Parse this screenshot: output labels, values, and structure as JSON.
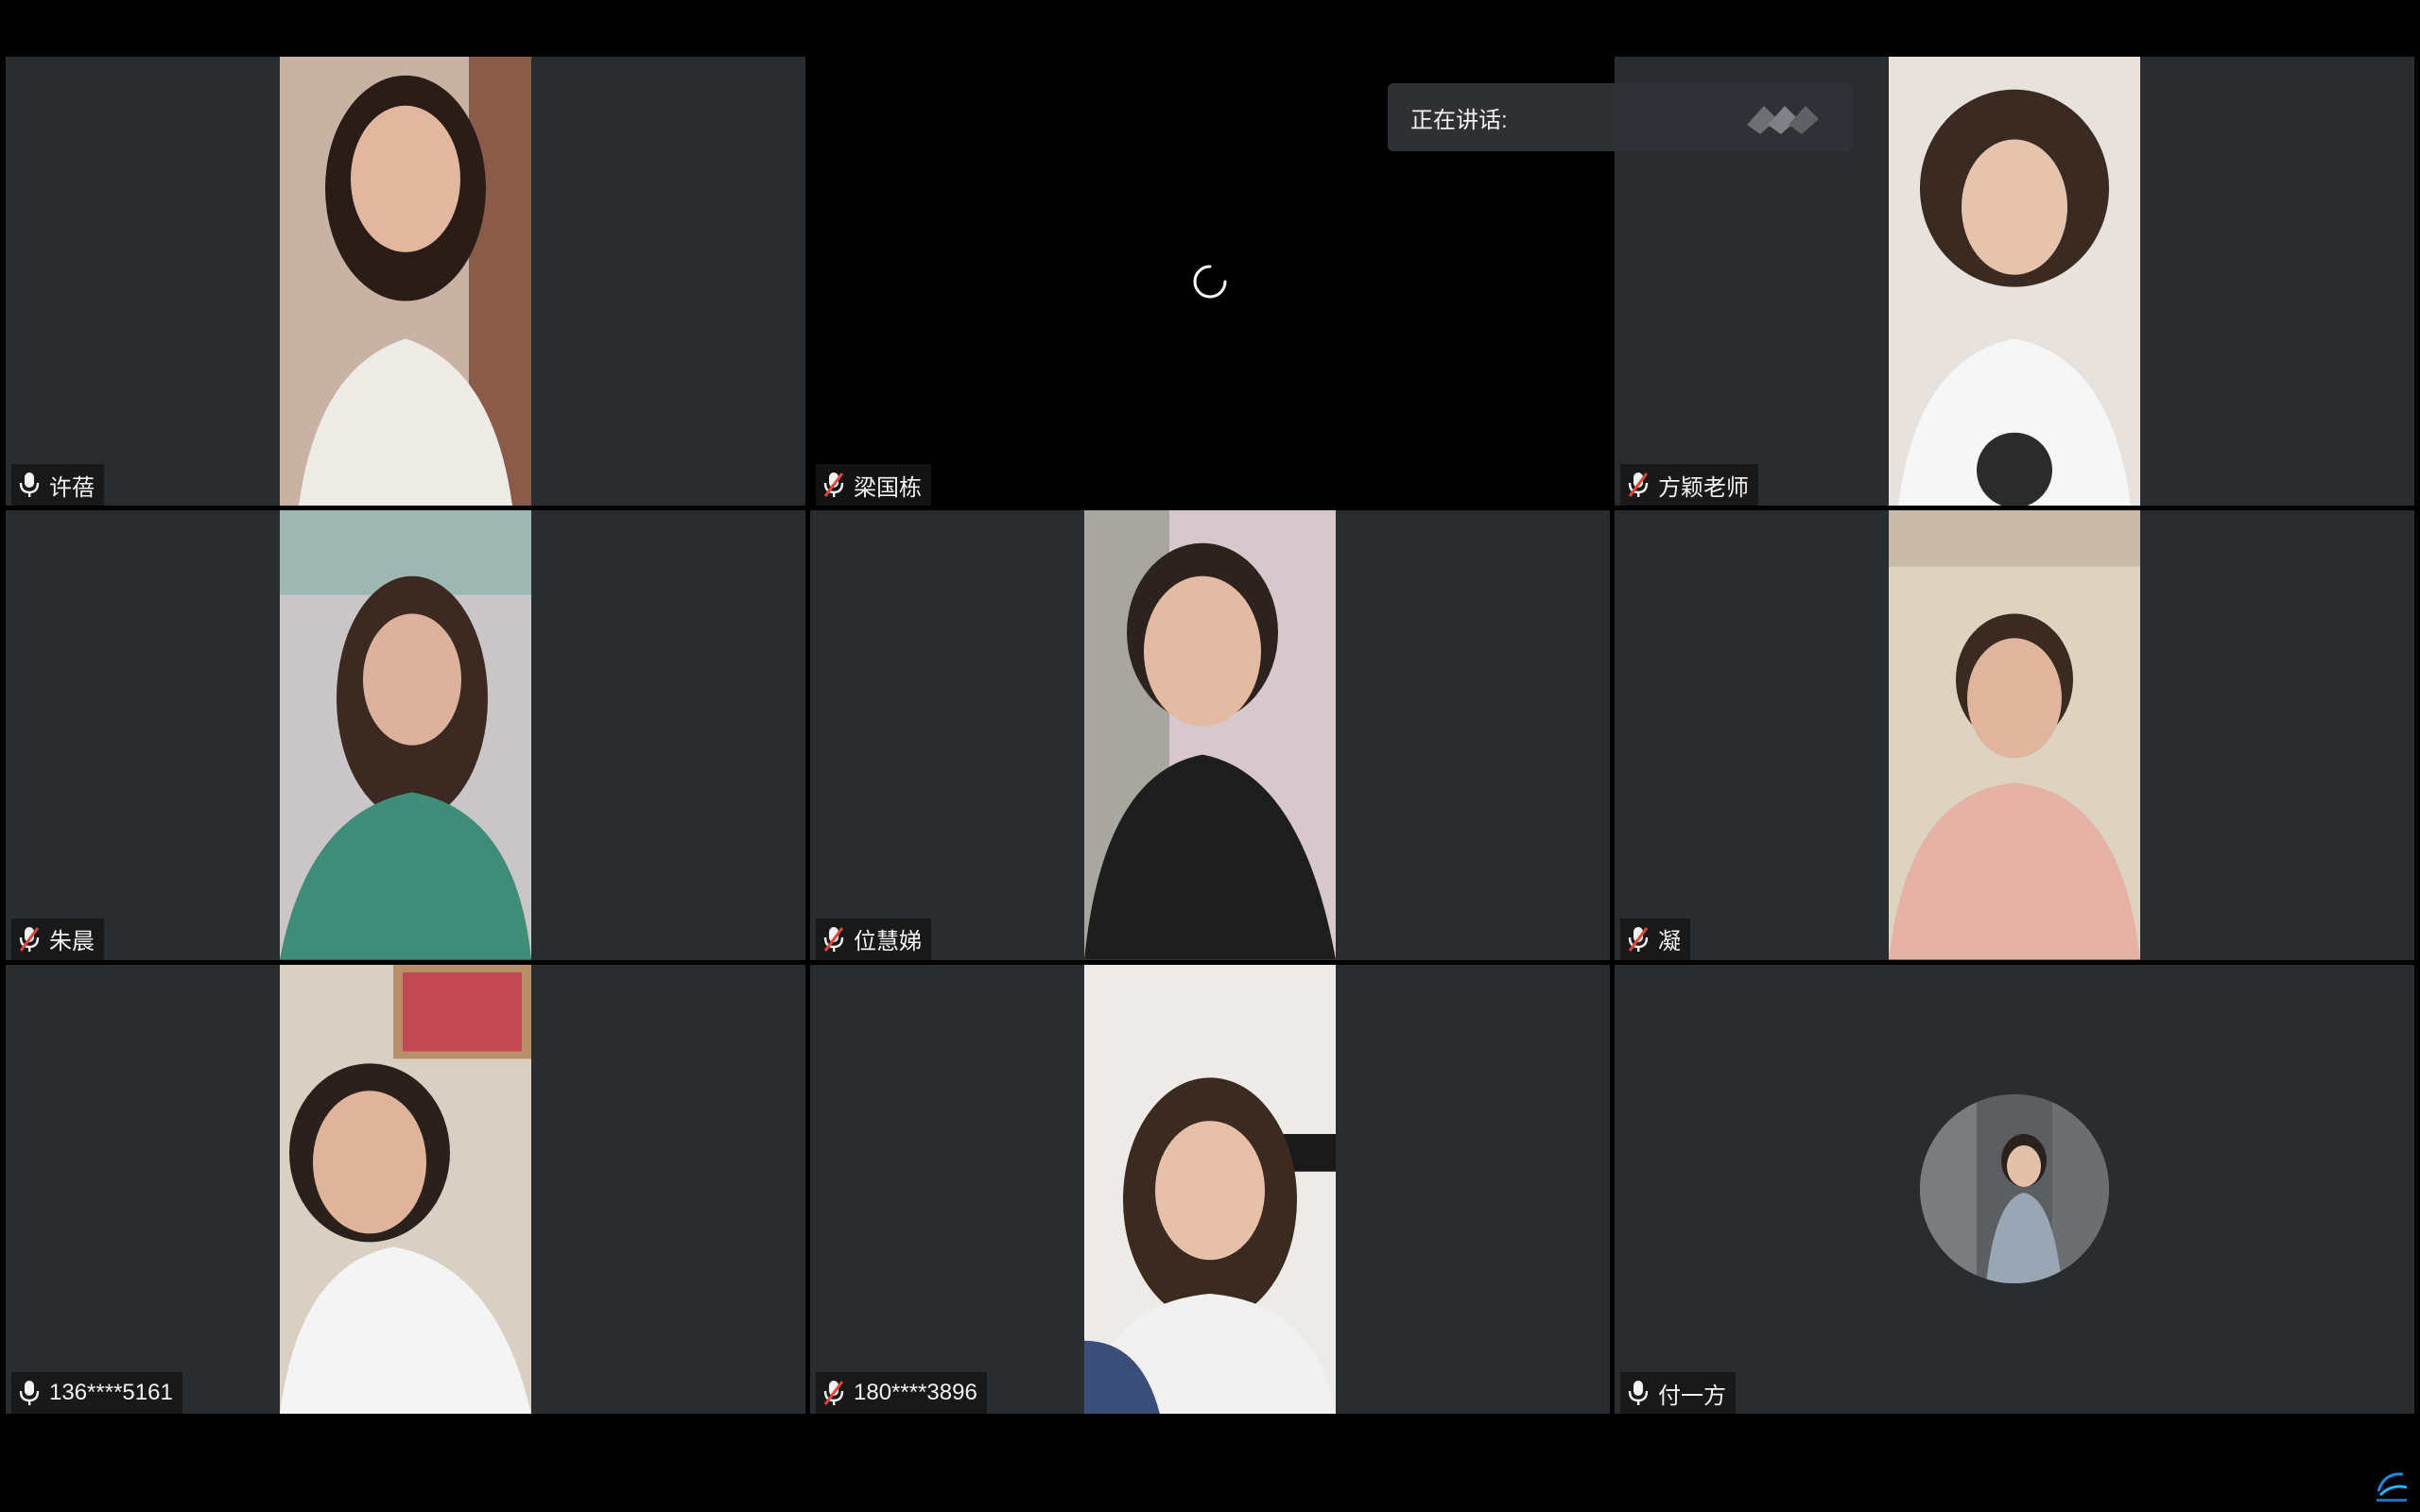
{
  "speaking_panel": {
    "label": "正在讲话:"
  },
  "participants": [
    {
      "name": "许蓓",
      "mic": "on"
    },
    {
      "name": "梁国栋",
      "mic": "muted"
    },
    {
      "name": "方颖老师",
      "mic": "muted"
    },
    {
      "name": "朱晨",
      "mic": "muted"
    },
    {
      "name": "位慧娣",
      "mic": "muted"
    },
    {
      "name": "凝",
      "mic": "muted"
    },
    {
      "name": "136****5161",
      "mic": "on"
    },
    {
      "name": "180****3896",
      "mic": "muted"
    },
    {
      "name": "付一方",
      "mic": "on"
    }
  ],
  "colors": {
    "tile_bg": "#2a2d30",
    "window_bg": "#000000",
    "mute_red": "#e0463c",
    "label_text": "#f2f2f2"
  },
  "icons": {
    "mic_on": "microphone-icon",
    "mic_muted": "microphone-muted-icon",
    "loading": "loading-spinner-icon",
    "speaking": "speaking-indicator-icon",
    "logo": "app-logo-icon"
  }
}
